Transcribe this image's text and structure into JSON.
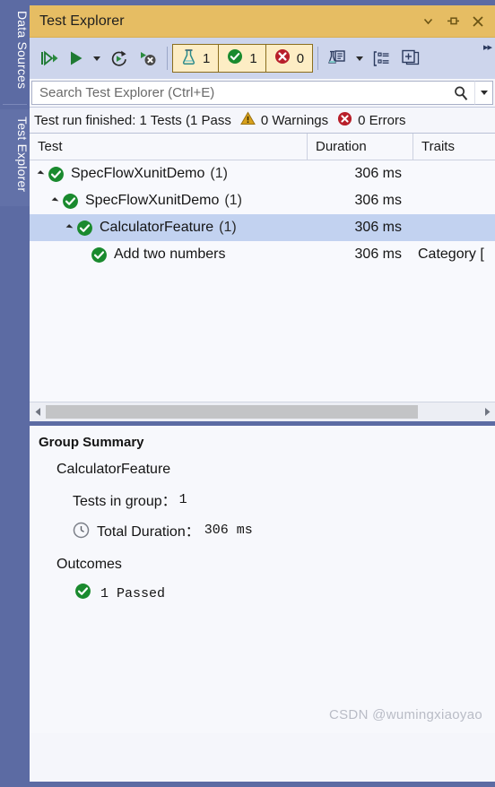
{
  "side_tabs": [
    {
      "label": "Data Sources",
      "name": "data-sources"
    },
    {
      "label": "Test Explorer",
      "name": "test-explorer"
    }
  ],
  "window": {
    "title": "Test Explorer",
    "title_buttons": [
      {
        "name": "window-dropdown-icon",
        "glyph": "chevron-down"
      },
      {
        "name": "pin-icon",
        "glyph": "pin"
      },
      {
        "name": "close-icon",
        "glyph": "close"
      }
    ]
  },
  "toolbar": {
    "run_all_label": "Run All Tests",
    "run_label": "Run",
    "run_dropdown_label": "Run dropdown",
    "repeat_label": "Repeat Last Run",
    "stop_label": "Stop Test Run",
    "counters": [
      {
        "name": "total-tests",
        "icon": "flask-icon",
        "value": "1"
      },
      {
        "name": "passed-tests",
        "icon": "check-circle-icon",
        "value": "1"
      },
      {
        "name": "failed-tests",
        "icon": "error-circle-icon",
        "value": "0"
      }
    ],
    "settings_label": "Test Settings",
    "settings_dropdown_label": "Test Settings dropdown",
    "grouping_label": "Group By",
    "columns_label": "Show Test Output",
    "overflow_label": "More options"
  },
  "search": {
    "placeholder": "Search Test Explorer (Ctrl+E)",
    "value": "",
    "icon": "magnifier-icon",
    "dropdown_icon": "chevron-down-icon"
  },
  "status": {
    "run_text": "Test run finished: 1 Tests (1 Pass",
    "warnings": "0 Warnings",
    "errors": "0 Errors",
    "warning_icon": "warning-triangle-icon",
    "error_icon": "error-circle-icon"
  },
  "grid": {
    "columns": [
      "Test",
      "Duration",
      "Traits"
    ],
    "rows": [
      {
        "indent": 0,
        "expander": "expanded",
        "status": "passed",
        "name": "SpecFlowXunitDemo",
        "count": "(1)",
        "duration": "306 ms",
        "traits": "",
        "selected": false
      },
      {
        "indent": 1,
        "expander": "expanded",
        "status": "passed",
        "name": "SpecFlowXunitDemo",
        "count": "(1)",
        "duration": "306 ms",
        "traits": "",
        "selected": false
      },
      {
        "indent": 2,
        "expander": "expanded",
        "status": "passed",
        "name": "CalculatorFeature",
        "count": "(1)",
        "duration": "306 ms",
        "traits": "",
        "selected": true
      },
      {
        "indent": 3,
        "expander": "none",
        "status": "passed",
        "name": "Add two numbers",
        "count": "",
        "duration": "306 ms",
        "traits": "Category [",
        "selected": false
      }
    ]
  },
  "scrollbar": {
    "left_arrow": "scroll-left-arrow-icon",
    "right_arrow": "scroll-right-arrow-icon"
  },
  "summary": {
    "heading": "Group Summary",
    "group_name": "CalculatorFeature",
    "tests_in_group_label": "Tests in group：",
    "tests_in_group_value": "1",
    "total_duration_label": "Total Duration：",
    "total_duration_value": "306 ms",
    "clock_icon": "clock-icon",
    "outcomes_heading": "Outcomes",
    "outcome_icon": "check-circle-icon",
    "outcome_text": "1 Passed"
  },
  "watermark": "CSDN @wumingxiaoyao"
}
